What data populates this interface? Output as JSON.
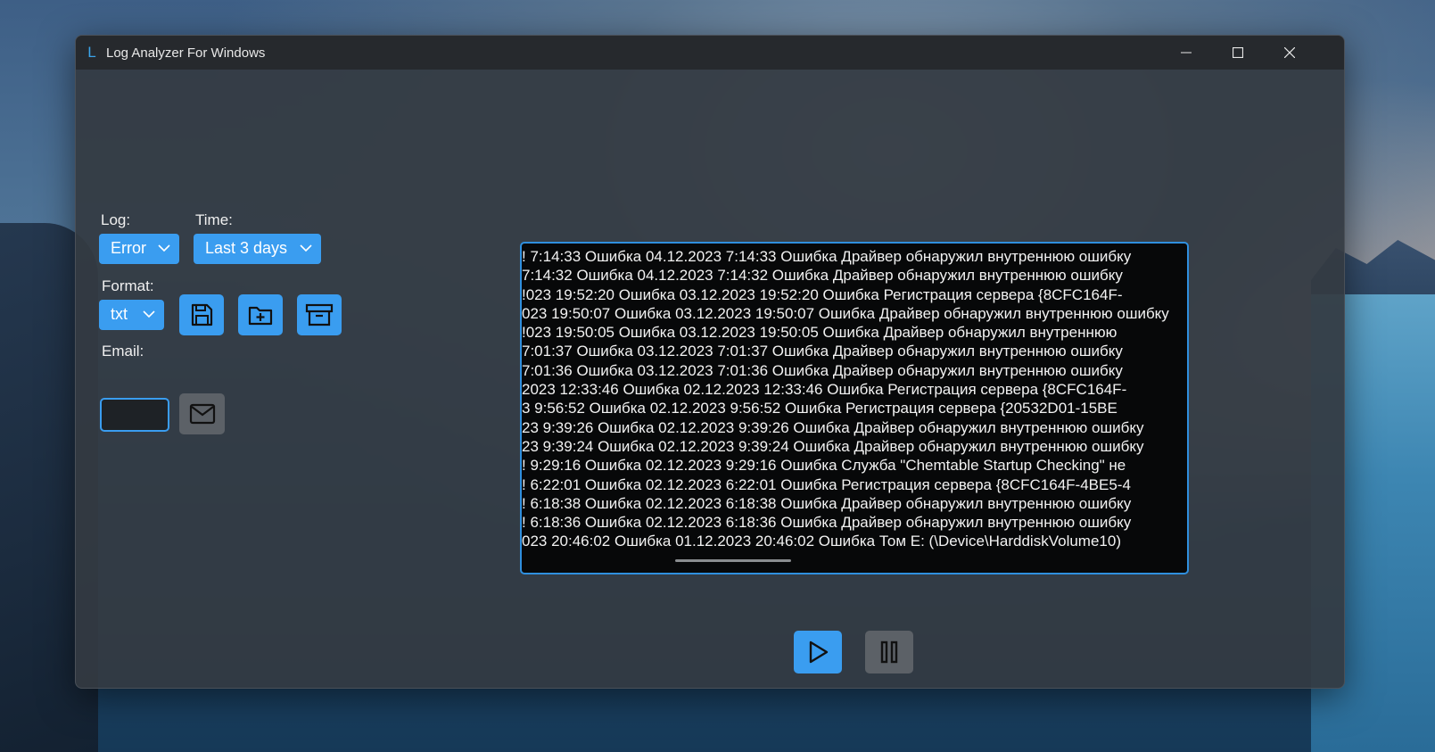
{
  "window": {
    "title": "Log Analyzer For Windows"
  },
  "controls": {
    "log_label": "Log:",
    "log_value": "Error",
    "time_label": "Time:",
    "time_value": "Last 3 days",
    "format_label": "Format:",
    "format_value": "txt",
    "email_label": "Email:",
    "email_value": ""
  },
  "icons": {
    "app": "log-analyzer-app-icon",
    "save": "save-icon",
    "folder_add": "folder-add-icon",
    "archive": "archive-icon",
    "email": "mail-icon",
    "start": "play-icon",
    "pause": "pause-icon"
  },
  "log_lines": [
    "! 7:14:33 Ошибка 04.12.2023 7:14:33 Ошибка Драйвер обнаружил внутреннюю ошибку",
    " 7:14:32 Ошибка 04.12.2023 7:14:32 Ошибка Драйвер обнаружил внутреннюю ошибку",
    "!023 19:52:20 Ошибка 03.12.2023 19:52:20 Ошибка Регистрация сервера {8CFC164F-",
    "023 19:50:07 Ошибка 03.12.2023 19:50:07 Ошибка Драйвер обнаружил внутреннюю ошибку",
    "!023 19:50:05 Ошибка 03.12.2023 19:50:05 Ошибка Драйвер обнаружил внутреннюю",
    " 7:01:37 Ошибка 03.12.2023 7:01:37 Ошибка Драйвер обнаружил внутреннюю ошибку",
    " 7:01:36 Ошибка 03.12.2023 7:01:36 Ошибка Драйвер обнаружил внутреннюю ошибку",
    "2023 12:33:46 Ошибка 02.12.2023 12:33:46 Ошибка Регистрация сервера {8CFC164F-",
    "3 9:56:52 Ошибка 02.12.2023 9:56:52 Ошибка Регистрация сервера {20532D01-15BE",
    "23 9:39:26 Ошибка 02.12.2023 9:39:26 Ошибка Драйвер обнаружил внутреннюю ошибку",
    "23 9:39:24 Ошибка 02.12.2023 9:39:24 Ошибка Драйвер обнаружил внутреннюю ошибку",
    "! 9:29:16 Ошибка 02.12.2023 9:29:16 Ошибка Служба \"Chemtable Startup Checking\" не",
    "! 6:22:01 Ошибка 02.12.2023 6:22:01 Ошибка Регистрация сервера {8CFC164F-4BE5-4",
    "! 6:18:38 Ошибка 02.12.2023 6:18:38 Ошибка Драйвер обнаружил внутреннюю ошибку",
    "! 6:18:36 Ошибка 02.12.2023 6:18:36 Ошибка Драйвер обнаружил внутреннюю ошибку",
    "023 20:46:02 Ошибка 01.12.2023 20:46:02 Ошибка Том E: (\\Device\\HarddiskVolume10)"
  ],
  "colors": {
    "accent": "#3a9df0",
    "window_bg": "#343a42",
    "titlebar_bg": "#26292d",
    "log_bg": "#070809",
    "disabled_button": "#5c6167"
  }
}
